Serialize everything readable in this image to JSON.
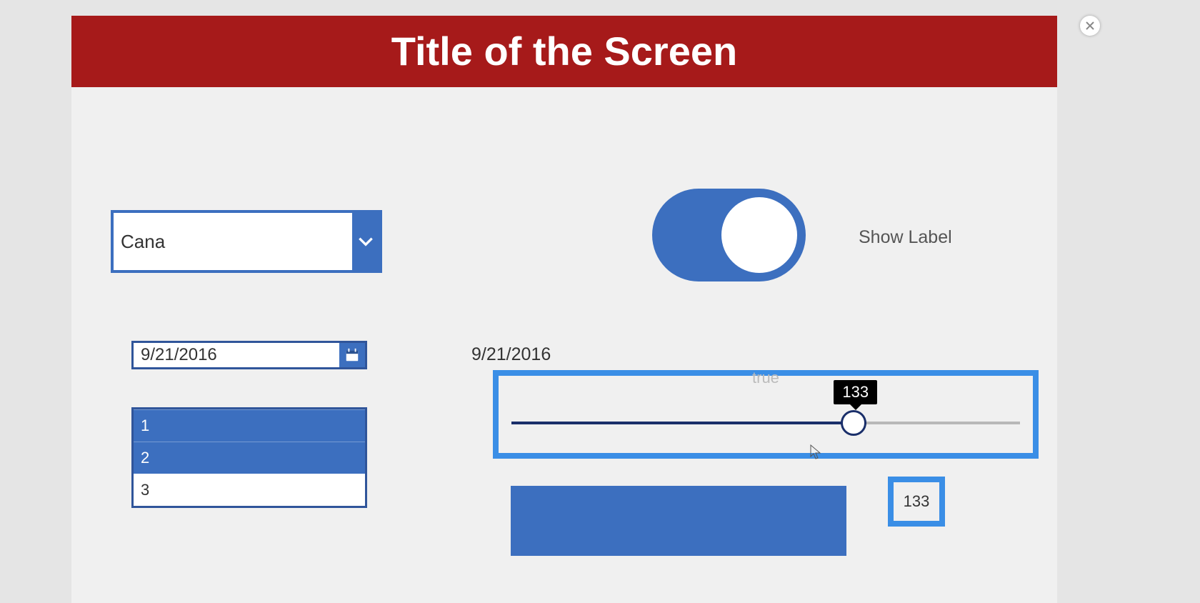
{
  "header": {
    "title": "Title of the Screen"
  },
  "combo": {
    "value": "Cana"
  },
  "toggle": {
    "on": true,
    "label": "Show Label",
    "text_true": "true"
  },
  "date": {
    "value": "9/21/2016",
    "echo": "9/21/2016"
  },
  "list": {
    "items": [
      "1",
      "2",
      "3"
    ],
    "selected": [
      0,
      1
    ]
  },
  "slider": {
    "value": 133,
    "min": 0,
    "max": 200
  },
  "valuebox": {
    "text": "133"
  }
}
